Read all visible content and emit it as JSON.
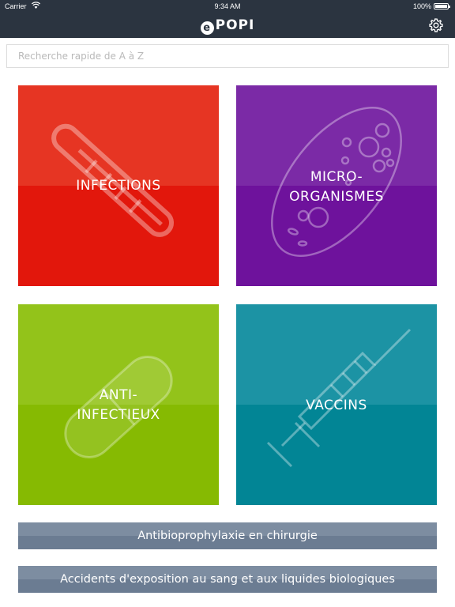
{
  "status_bar": {
    "carrier": "Carrier",
    "time": "9:34 AM",
    "battery": "100%"
  },
  "nav": {
    "logo_letter": "e",
    "logo_text": "POPI",
    "settings_icon": "gear-icon"
  },
  "search": {
    "placeholder": "Recherche rapide de A à Z"
  },
  "tiles": [
    {
      "label_lines": [
        "INFECTIONS"
      ],
      "icon": "thermometer-icon",
      "color_top": "#e63523",
      "color_bottom": "#e2170c"
    },
    {
      "label_lines": [
        "MICRO-",
        "ORGANISMES"
      ],
      "icon": "bacteria-icon",
      "color_top": "#7b2aa6",
      "color_bottom": "#6e129c"
    },
    {
      "label_lines": [
        "ANTI-",
        "INFECTIEUX"
      ],
      "icon": "pill-icon",
      "color_top": "#93c31a",
      "color_bottom": "#86ba02"
    },
    {
      "label_lines": [
        "VACCINS"
      ],
      "icon": "syringe-icon",
      "color_top": "#1c93a4",
      "color_bottom": "#028595"
    }
  ],
  "buttons": [
    {
      "label": "Antibioprophylaxie en chirurgie"
    },
    {
      "label": "Accidents d'exposition au sang et aux liquides biologiques"
    }
  ],
  "colors": {
    "nav_bg": "#2b3440",
    "button_top": "#7d8da1",
    "button_bottom": "#6b7c92"
  }
}
